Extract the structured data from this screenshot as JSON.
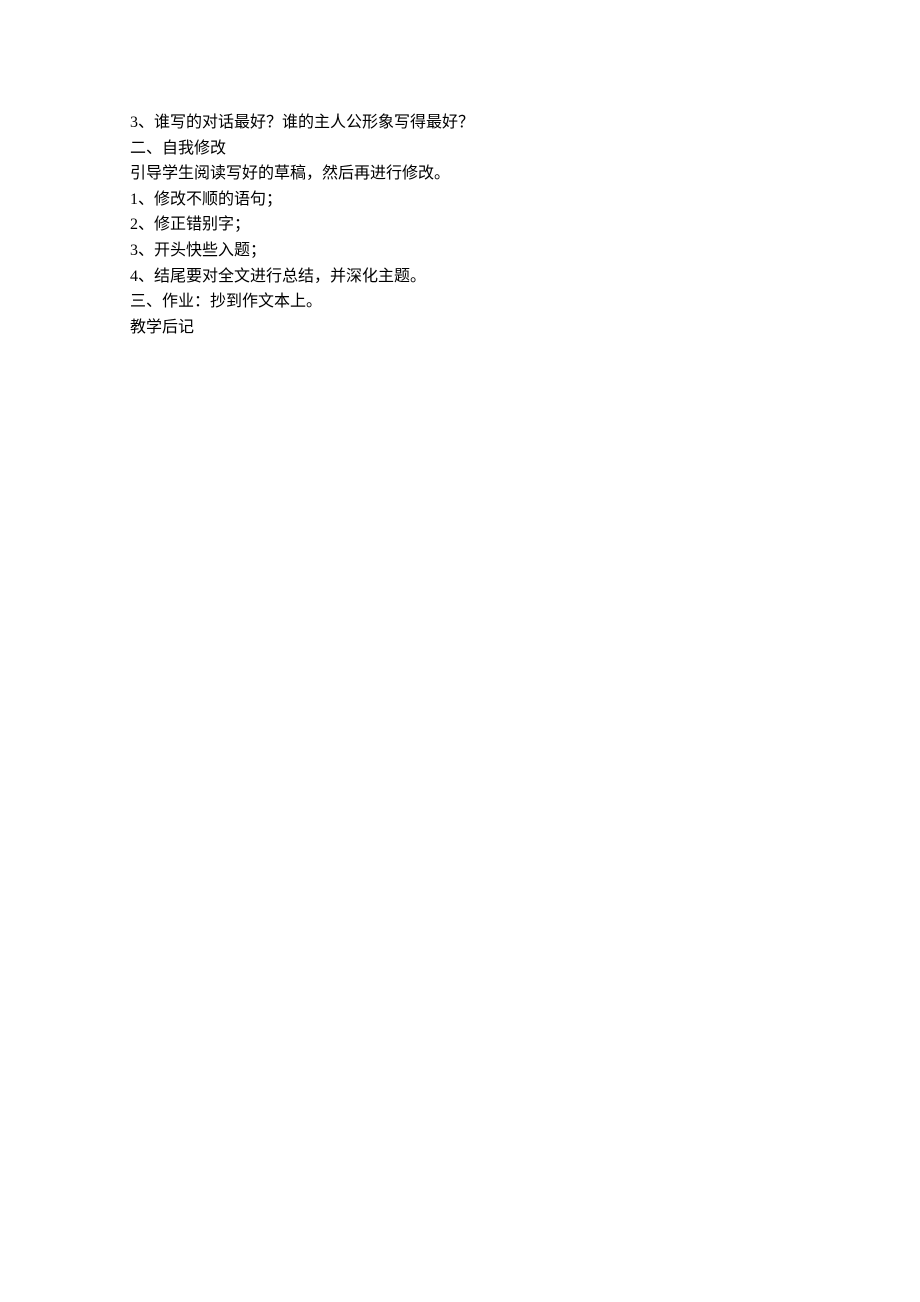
{
  "lines": [
    "3、谁写的对话最好？谁的主人公形象写得最好？",
    "二、自我修改",
    "引导学生阅读写好的草稿，然后再进行修改。",
    "1、修改不顺的语句；",
    "2、修正错别字；",
    "3、开头快些入题；",
    "4、结尾要对全文进行总结，并深化主题。",
    "三、作业：抄到作文本上。",
    "教学后记"
  ]
}
